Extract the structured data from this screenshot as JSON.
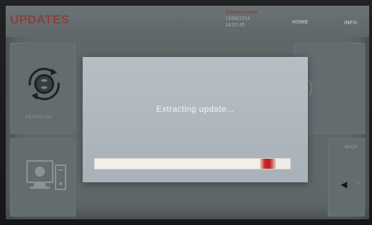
{
  "header": {
    "app_title": "UPDATES",
    "user": {
      "name": "Administrator",
      "date": "13/06/2014",
      "time": "14:57:45"
    },
    "nav": {
      "home": "HOME",
      "info": "INFO"
    }
  },
  "tiles": {
    "keyonline_label": "KEYONLINE",
    "back_label": "BACK"
  },
  "modal": {
    "message": "Extracting update...",
    "progress": 0.92
  },
  "colors": {
    "accent_red": "#a2443f",
    "progress_red": "#c42a26",
    "screen_gray": "#6c7477",
    "modal_bg": "#b6bfc5"
  },
  "icons": [
    "sync-icon",
    "computer-icon",
    "arrow-left-icon",
    "arrow-right-icon"
  ]
}
